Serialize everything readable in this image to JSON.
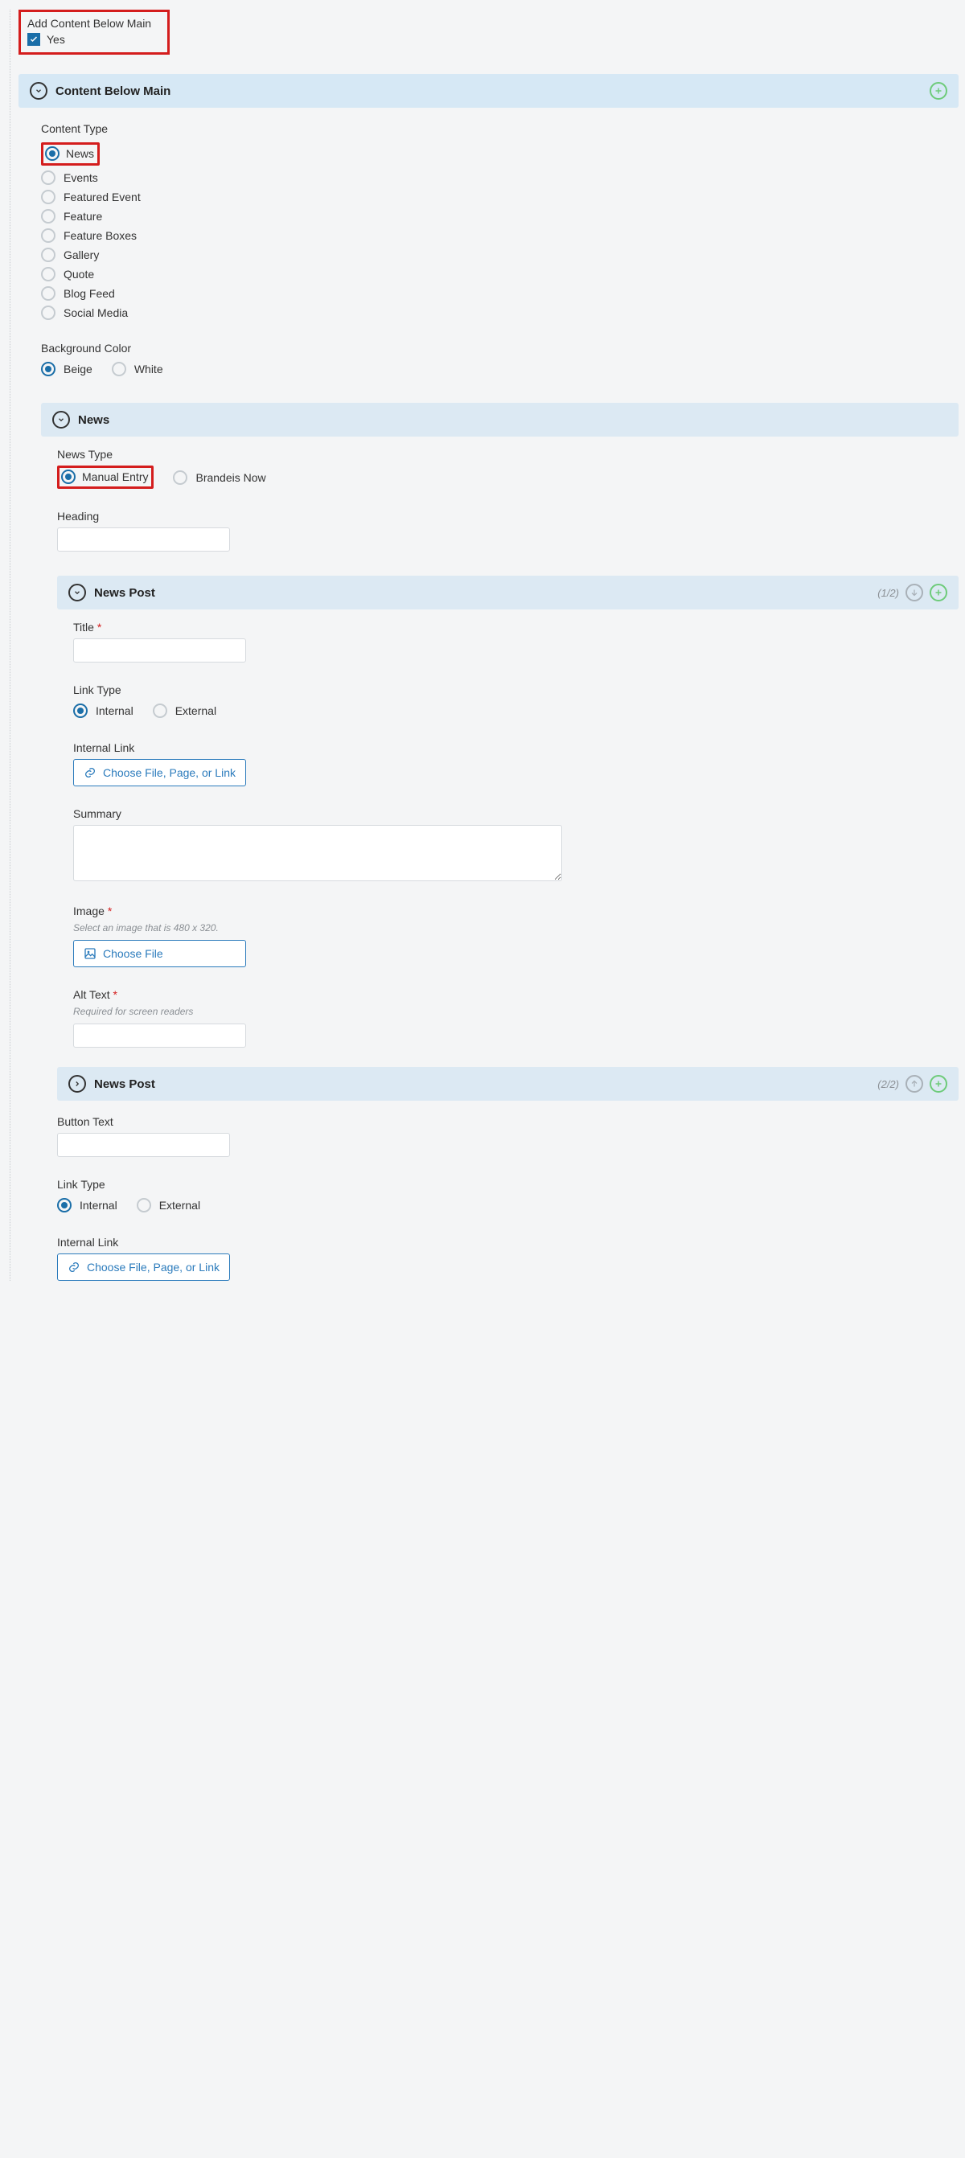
{
  "top": {
    "label": "Add Content Below Main",
    "checkbox_label": "Yes"
  },
  "cbm": {
    "title": "Content Below Main",
    "content_type_label": "Content Type",
    "options": [
      "News",
      "Events",
      "Featured Event",
      "Feature",
      "Feature Boxes",
      "Gallery",
      "Quote",
      "Blog Feed",
      "Social Media"
    ],
    "selected": "News",
    "bg_label": "Background Color",
    "bg_options": [
      "Beige",
      "White"
    ],
    "bg_selected": "Beige"
  },
  "news": {
    "title": "News",
    "type_label": "News Type",
    "type_options": [
      "Manual Entry",
      "Brandeis Now"
    ],
    "type_selected": "Manual Entry",
    "heading_label": "Heading"
  },
  "post1": {
    "title": "News Post",
    "counter": "(1/2)",
    "title_field": "Title",
    "link_type_label": "Link Type",
    "link_type_options": [
      "Internal",
      "External"
    ],
    "link_type_selected": "Internal",
    "internal_link_label": "Internal Link",
    "chooser_label": "Choose File, Page, or Link",
    "summary_label": "Summary",
    "image_label": "Image",
    "image_hint": "Select an image that is 480 x 320.",
    "choose_file_label": "Choose File",
    "alt_label": "Alt Text",
    "alt_hint": "Required for screen readers"
  },
  "post2": {
    "title": "News Post",
    "counter": "(2/2)"
  },
  "bottom": {
    "button_text_label": "Button Text",
    "link_type_label": "Link Type",
    "link_type_options": [
      "Internal",
      "External"
    ],
    "link_type_selected": "Internal",
    "internal_link_label": "Internal Link",
    "chooser_label": "Choose File, Page, or Link"
  }
}
